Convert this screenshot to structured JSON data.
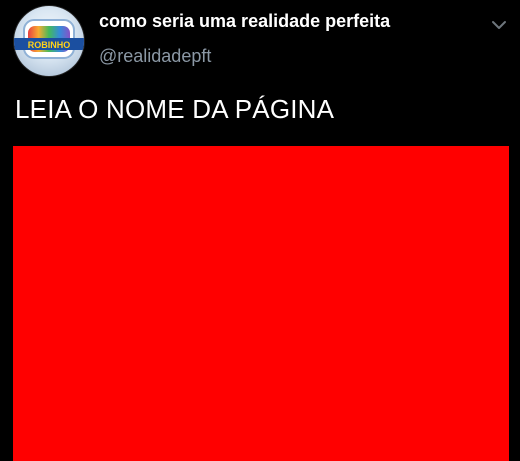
{
  "tweet": {
    "display_name": "como seria uma realidade perfeita",
    "handle": "@realidadepft",
    "text": "LEIA O NOME DA PÁGINA",
    "menu_icon": "chevron-down-icon",
    "avatar_logo_text": "ROBINHO"
  },
  "colors": {
    "background": "#000000",
    "name": "#ffffff",
    "handle": "#8b98a5",
    "media": "#ff0000"
  }
}
